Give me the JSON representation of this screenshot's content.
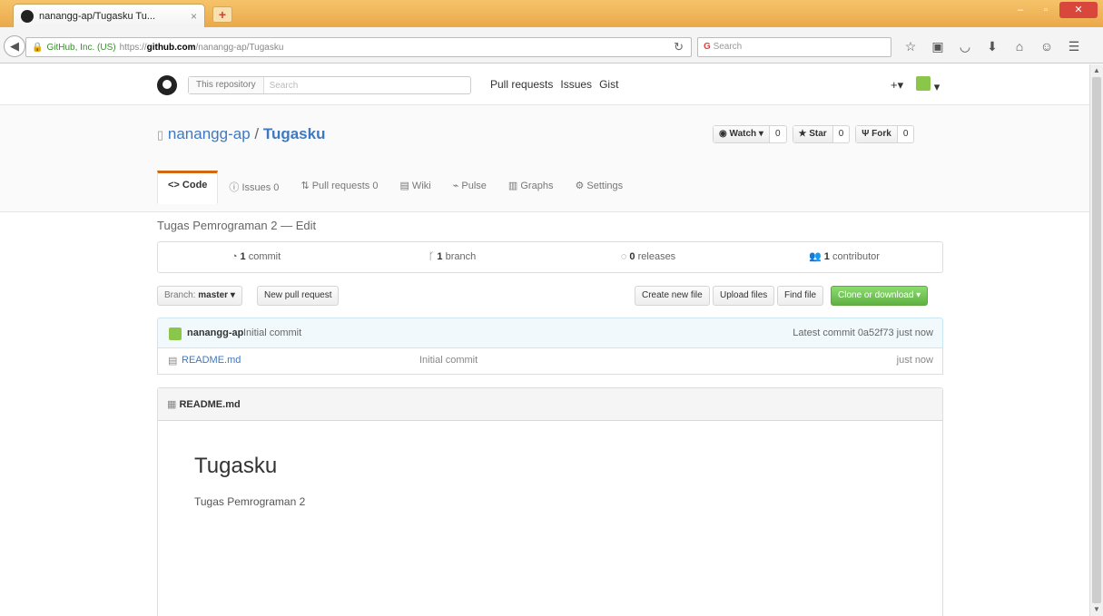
{
  "browser": {
    "tab_title": "nanangg-ap/Tugasku Tu...",
    "tab_close": "×",
    "new_tab": "+",
    "window_controls": {
      "minimize": "–",
      "maximize": "▫",
      "close": "✕"
    },
    "url": {
      "identity": "GitHub, Inc. (US)",
      "prefix": "https://",
      "domain": "github.com",
      "path": "/nanangg-ap/Tugasku"
    },
    "search_placeholder": "Search",
    "icons": [
      "star-icon",
      "bookmarks-icon",
      "pocket-icon",
      "downloads-icon",
      "home-icon",
      "chat-icon",
      "menu-icon"
    ]
  },
  "github": {
    "search_scope": "This repository",
    "search_placeholder": "Search",
    "nav": [
      "Pull requests",
      "Issues",
      "Gist"
    ],
    "plus": "+▾",
    "avatar_caret": "▾"
  },
  "repo": {
    "owner": "nanangg-ap",
    "separator": " / ",
    "name": "Tugasku",
    "watch": {
      "label": "◉ Watch ▾",
      "count": "0"
    },
    "star": {
      "label": "★ Star",
      "count": "0"
    },
    "fork": {
      "label": "Ψ Fork",
      "count": "0"
    },
    "tabs": [
      {
        "label": "<> Code",
        "selected": true
      },
      {
        "label": "ⓘ Issues 0",
        "selected": false
      },
      {
        "label": "⇅ Pull requests 0",
        "selected": false
      },
      {
        "label": "▤ Wiki",
        "selected": false
      },
      {
        "label": "⌁ Pulse",
        "selected": false
      },
      {
        "label": "▥ Graphs",
        "selected": false
      },
      {
        "label": "⚙ Settings",
        "selected": false
      }
    ],
    "description": "Tugas Pemrograman 2 — Edit",
    "summary": [
      {
        "num": "1",
        "label": " commit"
      },
      {
        "num": "1",
        "label": " branch"
      },
      {
        "num": "0",
        "label": " releases"
      },
      {
        "num": "1",
        "label": " contributor"
      }
    ],
    "branch_label": "Branch:",
    "branch_name": "master ▾",
    "new_pr": "New pull request",
    "create_file": "Create new file",
    "upload": "Upload files",
    "find": "Find file",
    "clone": "Clone or download ▾",
    "commit": {
      "author": "nanangg-ap",
      "message": "Initial commit",
      "latest": "Latest commit 0a52f73 just now"
    },
    "files": [
      {
        "name": "README.md",
        "message": "Initial commit",
        "age": "just now"
      }
    ],
    "readme": {
      "header": "README.md",
      "title": "Tugasku",
      "text": "Tugas Pemrograman 2"
    }
  }
}
